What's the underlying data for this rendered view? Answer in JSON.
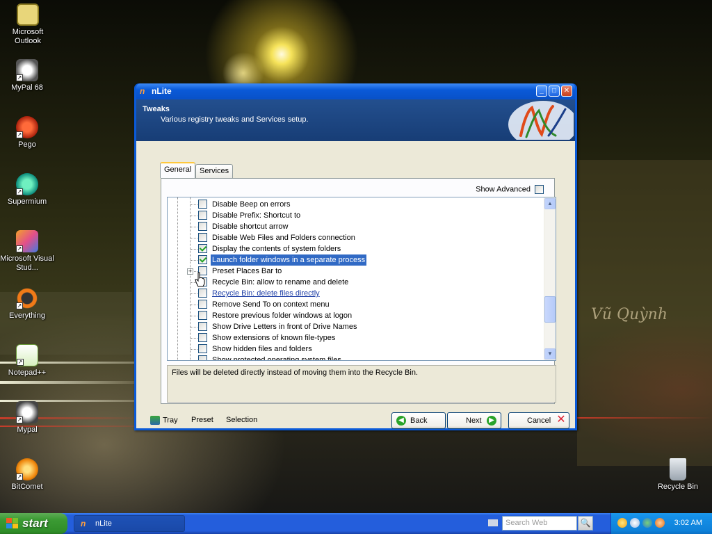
{
  "desktop": {
    "icons": [
      {
        "label": "Microsoft Outlook",
        "icon": "outlook-icon"
      },
      {
        "label": "MyPal 68",
        "icon": "mypal-icon"
      },
      {
        "label": "Pego",
        "icon": "pego-icon"
      },
      {
        "label": "Supermium",
        "icon": "supermium-icon"
      },
      {
        "label": "Microsoft Visual Stud...",
        "icon": "visual-studio-icon"
      },
      {
        "label": "Everything",
        "icon": "everything-icon"
      },
      {
        "label": "Notepad++",
        "icon": "notepad-plus-plus-icon"
      },
      {
        "label": "Mypal",
        "icon": "mypal-icon"
      },
      {
        "label": "BitComet",
        "icon": "bitcomet-icon"
      },
      {
        "label": "Recycle Bin",
        "icon": "recycle-bin-icon"
      }
    ]
  },
  "window": {
    "title": "nLite",
    "header_title": "Tweaks",
    "header_subtitle": "Various registry tweaks and Services setup.",
    "tabs": [
      {
        "label": "General",
        "active": true
      },
      {
        "label": "Services",
        "active": false
      }
    ],
    "show_advanced_label": "Show Advanced",
    "show_advanced_checked": false,
    "tree_items": [
      {
        "label": "Disable Beep on errors",
        "checked": false
      },
      {
        "label": "Disable Prefix: Shortcut to",
        "checked": false
      },
      {
        "label": "Disable shortcut arrow",
        "checked": false
      },
      {
        "label": "Disable Web Files and Folders connection",
        "checked": false
      },
      {
        "label": "Display the contents of system folders",
        "checked": true
      },
      {
        "label": "Launch folder windows in a separate process",
        "checked": true,
        "selected": true
      },
      {
        "label": "Preset Places Bar to",
        "checked": false,
        "expandable": true
      },
      {
        "label": "Recycle Bin: allow to rename and delete",
        "checked": false
      },
      {
        "label": "Recycle Bin: delete files directly",
        "checked": false,
        "hover": true
      },
      {
        "label": "Remove Send To on context menu",
        "checked": false
      },
      {
        "label": "Restore previous folder windows at logon",
        "checked": false
      },
      {
        "label": "Show Drive Letters in front of Drive Names",
        "checked": false
      },
      {
        "label": "Show extensions of known file-types",
        "checked": false
      },
      {
        "label": "Show hidden files and folders",
        "checked": false
      },
      {
        "label": "Show protected operating system files",
        "checked": false
      }
    ],
    "description": "Files will be deleted directly instead of moving them into the Recycle Bin.",
    "footer": {
      "tray_label": "Tray",
      "preset_label": "Preset",
      "selection_label": "Selection",
      "back_label": "Back",
      "next_label": "Next",
      "cancel_label": "Cancel"
    }
  },
  "taskbar": {
    "start_label": "start",
    "task_label": "nLite",
    "search_placeholder": "Search Web",
    "clock": "3:02 AM"
  }
}
